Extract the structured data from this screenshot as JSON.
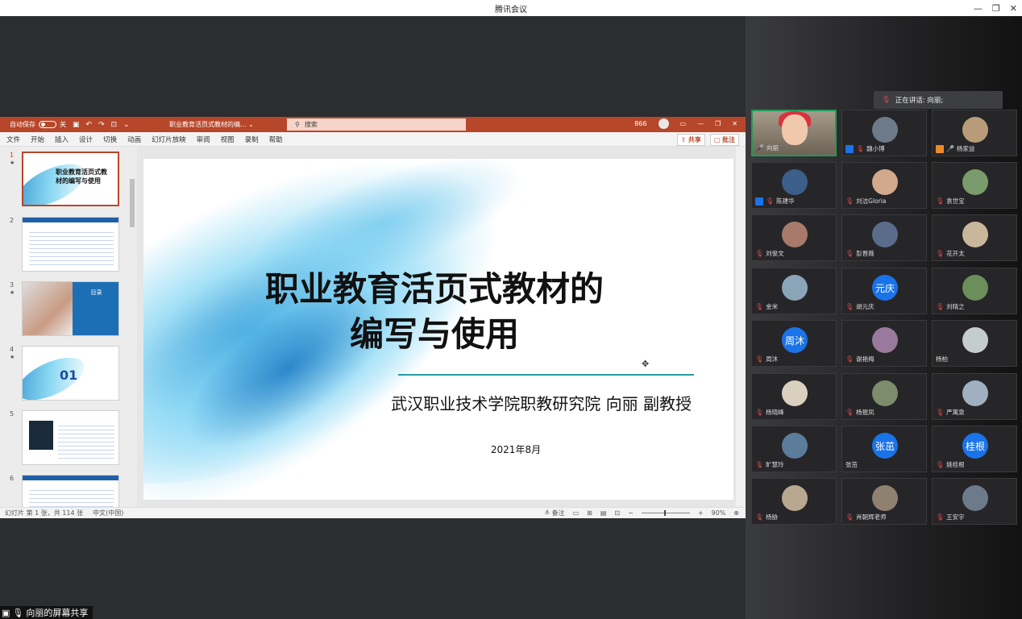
{
  "window": {
    "title": "腾讯会议"
  },
  "share": {
    "label": "向丽的屏幕共享"
  },
  "ppt": {
    "autosave_label": "自动保存",
    "autosave_state": "关",
    "doc_title": "职业教育活页式教材的编...",
    "search_placeholder": "搜索",
    "user_count": "866",
    "tabs": [
      "文件",
      "开始",
      "插入",
      "设计",
      "切换",
      "动画",
      "幻灯片放映",
      "审阅",
      "视图",
      "录制",
      "帮助"
    ],
    "share_button": "共享",
    "comment_button": "批注",
    "thumbnails": [
      {
        "num": "1",
        "star": "★",
        "title": "职业教育活页式教材的编写与使用"
      },
      {
        "num": "2",
        "star": "",
        "title": ""
      },
      {
        "num": "3",
        "star": "★",
        "title": "目录"
      },
      {
        "num": "4",
        "star": "★",
        "title": "01"
      },
      {
        "num": "5",
        "star": "",
        "title": ""
      },
      {
        "num": "6",
        "star": "",
        "title": ""
      }
    ],
    "slide": {
      "title_line1": "职业教育活页式教材的",
      "title_line2": "编写与使用",
      "subtitle": "武汉职业技术学院职教研究院  向丽  副教授",
      "date": "2021年8月"
    },
    "status": {
      "slide_info": "幻灯片 第 1 张，共 114 张",
      "language": "中文(中国)",
      "notes": "备注",
      "zoom": "90%"
    }
  },
  "meeting": {
    "speaking": "正在讲话: 向丽;",
    "participants": [
      {
        "name": "向丽",
        "mic": "on",
        "role": "",
        "avatar": "video",
        "avatar_text": ""
      },
      {
        "name": "魏小博",
        "mic": "off",
        "role": "host",
        "avatar": "photo",
        "avatar_text": ""
      },
      {
        "name": "杨家益",
        "mic": "on",
        "role": "cohost",
        "avatar": "photo",
        "avatar_text": ""
      },
      {
        "name": "陈建华",
        "mic": "off",
        "role": "host",
        "avatar": "photo",
        "avatar_text": ""
      },
      {
        "name": "刘洁Gloria",
        "mic": "off",
        "role": "",
        "avatar": "photo",
        "avatar_text": ""
      },
      {
        "name": "袁世宝",
        "mic": "off",
        "role": "",
        "avatar": "photo",
        "avatar_text": ""
      },
      {
        "name": "刘俊文",
        "mic": "off",
        "role": "",
        "avatar": "photo",
        "avatar_text": ""
      },
      {
        "name": "彭晋薇",
        "mic": "off",
        "role": "",
        "avatar": "photo",
        "avatar_text": ""
      },
      {
        "name": "花开太",
        "mic": "off",
        "role": "",
        "avatar": "photo",
        "avatar_text": ""
      },
      {
        "name": "金米",
        "mic": "off",
        "role": "",
        "avatar": "photo",
        "avatar_text": ""
      },
      {
        "name": "胡元庆",
        "mic": "off",
        "role": "",
        "avatar": "text",
        "avatar_text": "元庆"
      },
      {
        "name": "刘晴之",
        "mic": "off",
        "role": "",
        "avatar": "photo",
        "avatar_text": ""
      },
      {
        "name": "周沐",
        "mic": "off",
        "role": "",
        "avatar": "text",
        "avatar_text": "周沐"
      },
      {
        "name": "谢艳梅",
        "mic": "off",
        "role": "",
        "avatar": "photo",
        "avatar_text": ""
      },
      {
        "name": "杨柏",
        "mic": "none",
        "role": "",
        "avatar": "photo",
        "avatar_text": ""
      },
      {
        "name": "杨晓峰",
        "mic": "off",
        "role": "",
        "avatar": "photo",
        "avatar_text": ""
      },
      {
        "name": "杨振凤",
        "mic": "off",
        "role": "",
        "avatar": "photo",
        "avatar_text": ""
      },
      {
        "name": "严寓泉",
        "mic": "off",
        "role": "",
        "avatar": "photo",
        "avatar_text": ""
      },
      {
        "name": "旷慧玲",
        "mic": "off",
        "role": "",
        "avatar": "photo",
        "avatar_text": ""
      },
      {
        "name": "张茁",
        "mic": "none",
        "role": "",
        "avatar": "text",
        "avatar_text": "张茁"
      },
      {
        "name": "姚桂根",
        "mic": "off",
        "role": "",
        "avatar": "text",
        "avatar_text": "桂根"
      },
      {
        "name": "杨胁",
        "mic": "off",
        "role": "",
        "avatar": "photo",
        "avatar_text": ""
      },
      {
        "name": "肖朝辉老师",
        "mic": "off",
        "role": "",
        "avatar": "photo",
        "avatar_text": ""
      },
      {
        "name": "王安宇",
        "mic": "off",
        "role": "",
        "avatar": "photo",
        "avatar_text": ""
      }
    ]
  },
  "colors": {
    "ppt_accent": "#b7472a",
    "tile_avatar_blue": "#1a73e8",
    "active_speaker": "#1f9b58"
  }
}
